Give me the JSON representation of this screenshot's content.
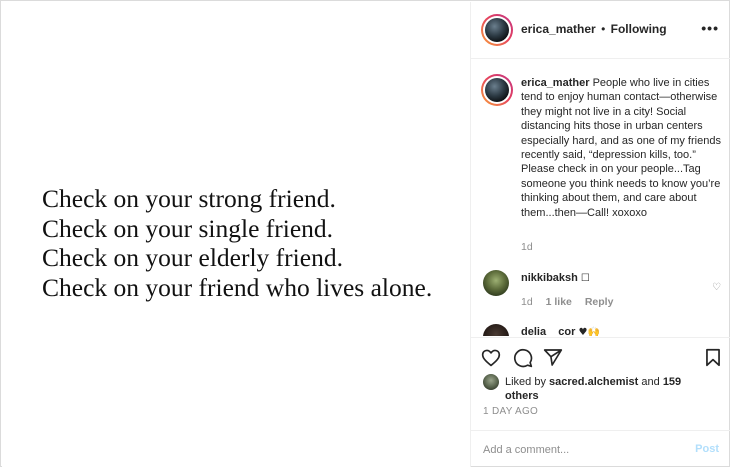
{
  "media": {
    "lines": [
      "Check on your strong friend.",
      "Check on your single friend.",
      "Check on your elderly friend.",
      "Check on your friend who lives alone."
    ]
  },
  "header": {
    "username": "erica_mather",
    "separator": "•",
    "follow_status": "Following",
    "more_icon": "more-icon"
  },
  "caption": {
    "username": "erica_mather",
    "text": "People who live in cities tend to enjoy human contact—otherwise they might not live in a city! Social distancing hits those in urban centers especially hard, and as one of my friends recently said, “depression kills, too.” Please check in on your people...Tag someone you think needs to know you’re thinking about them, and care about them...then—Call! xoxoxo",
    "time": "1d"
  },
  "comments": [
    {
      "username": "nikkibaksh",
      "text": "☐",
      "time": "1d",
      "likes": "1 like",
      "reply": "Reply"
    },
    {
      "username": "delia__cor",
      "text": "♥🙌"
    }
  ],
  "liked": {
    "prefix": "Liked by",
    "user": "sacred.alchemist",
    "and": "and",
    "others": "159 others"
  },
  "post_date": "1 DAY AGO",
  "add_comment": {
    "placeholder": "Add a comment...",
    "post_label": "Post"
  },
  "colors": {
    "accent_blue": "#b2dffc",
    "muted": "#8e8e8e",
    "text": "#262626",
    "border": "#efefef"
  }
}
